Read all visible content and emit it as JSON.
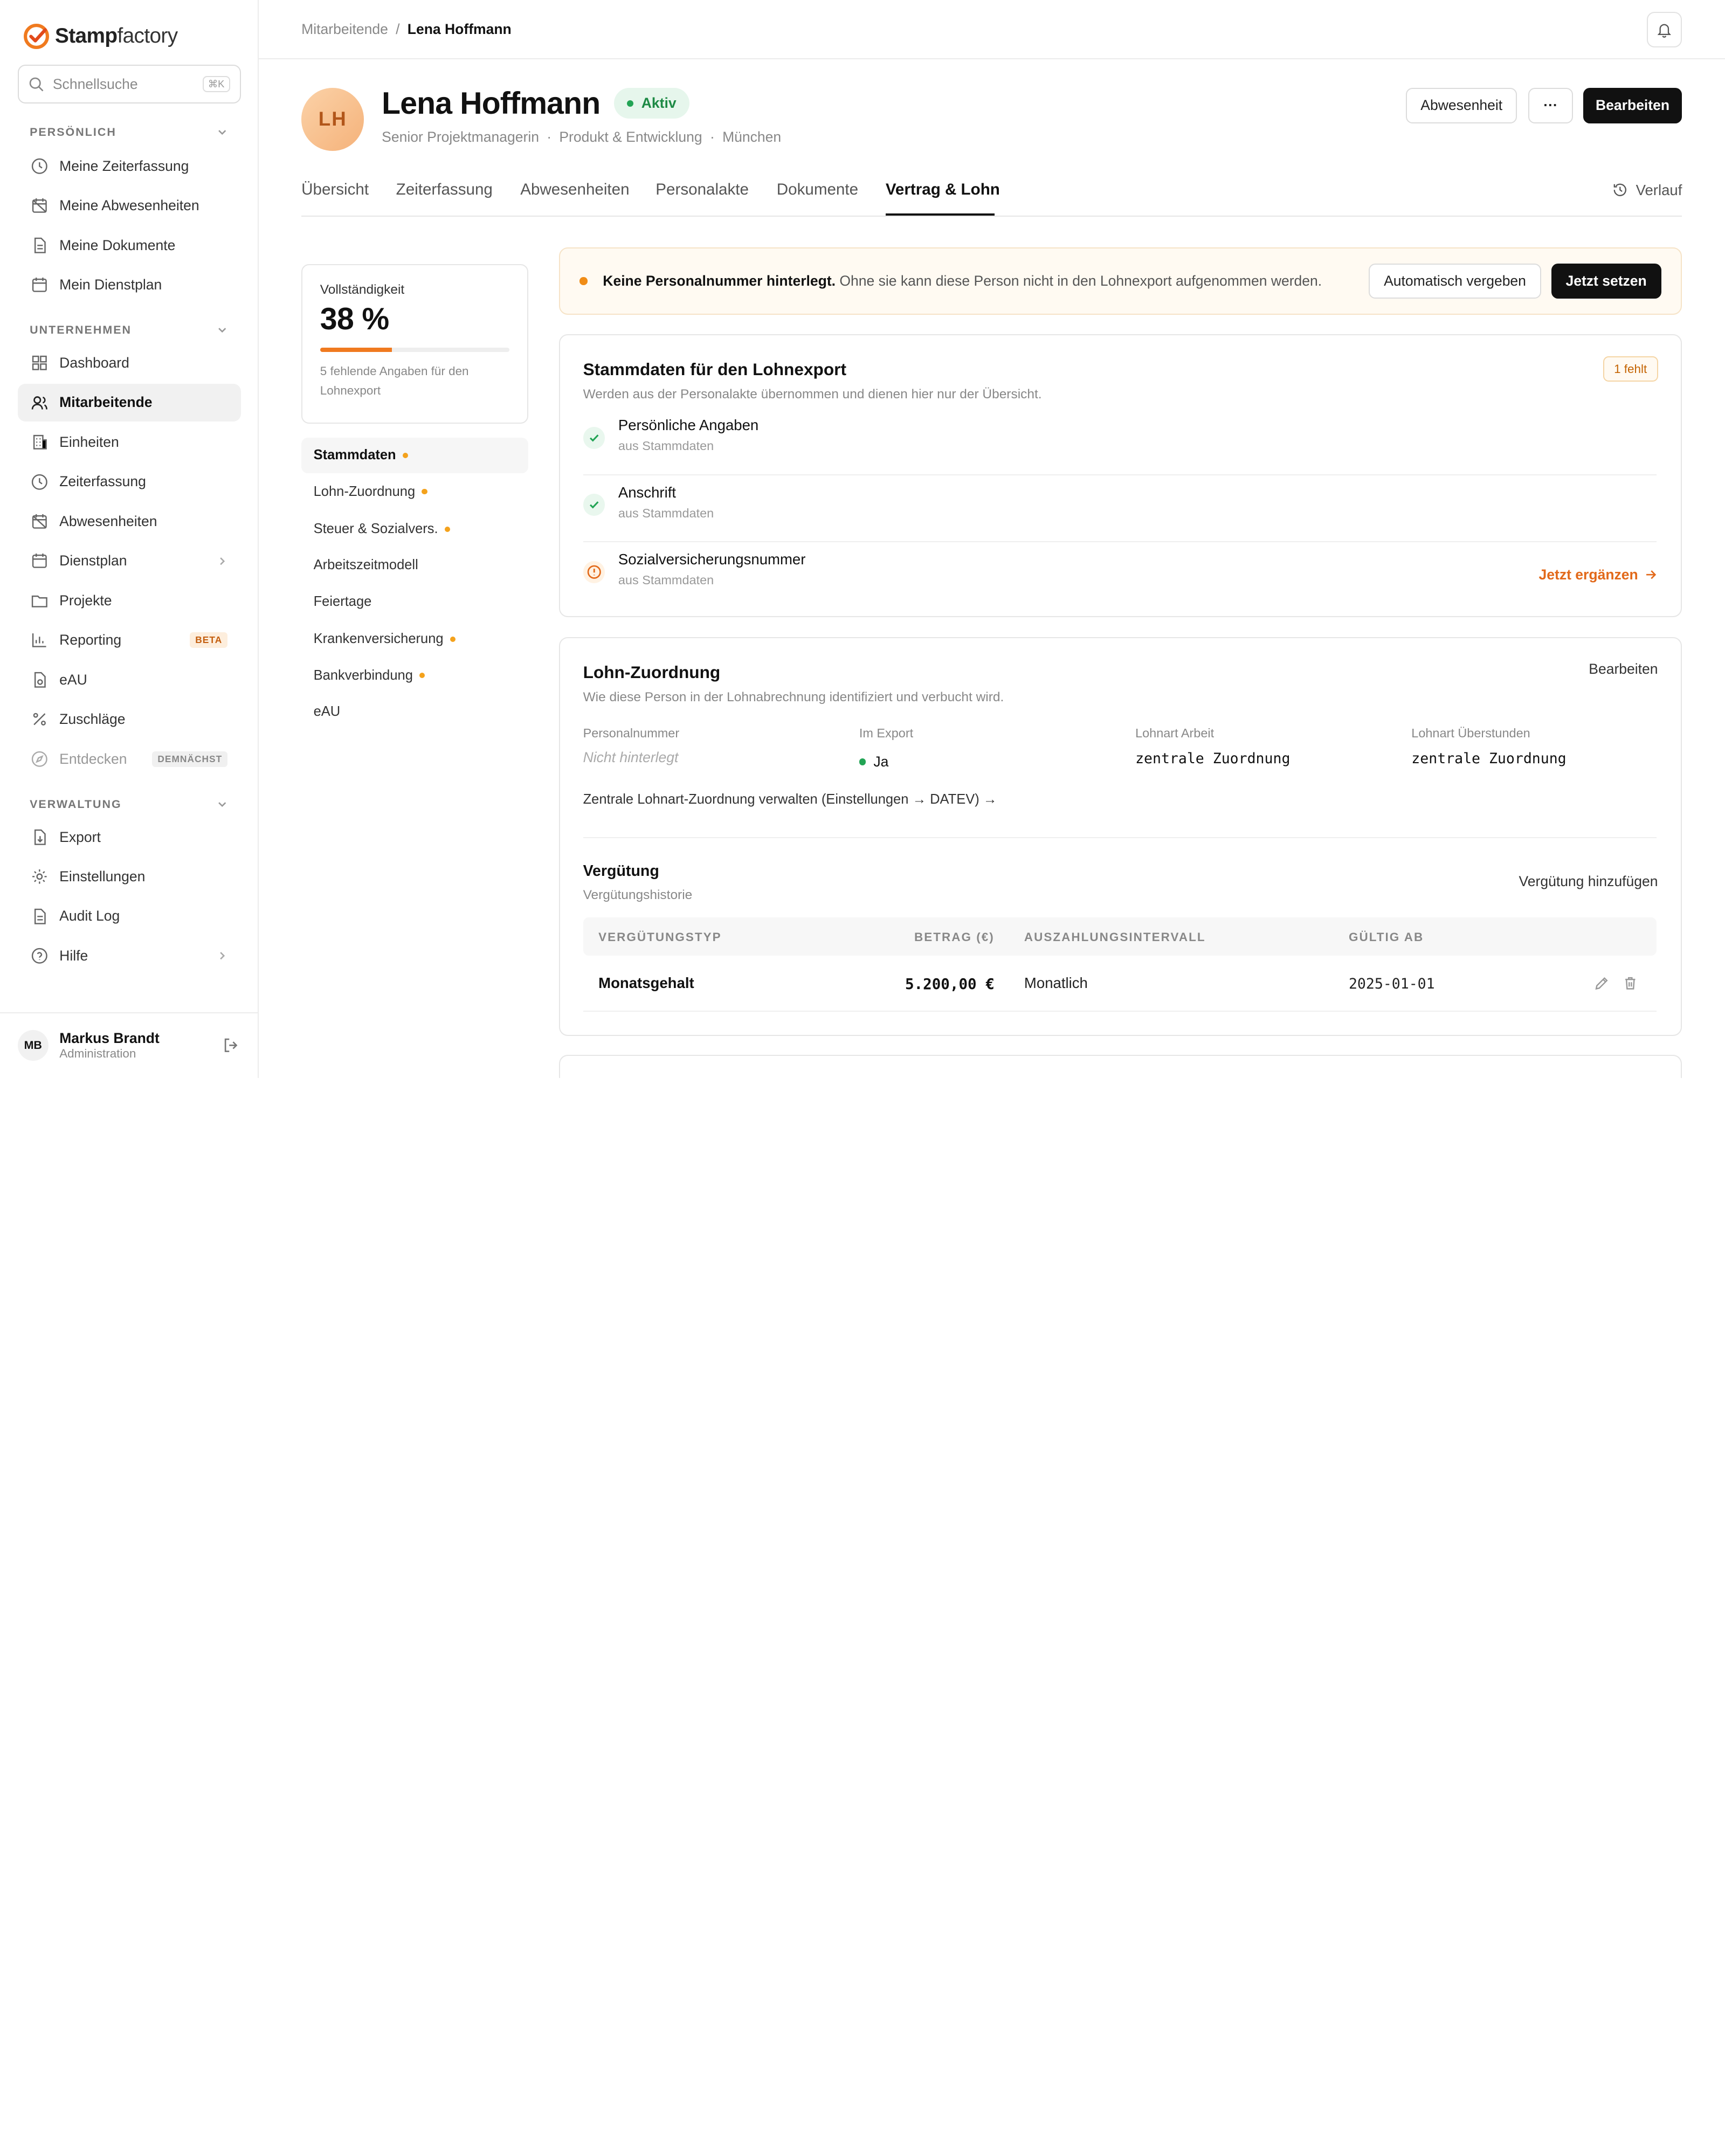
{
  "brand": {
    "part1": "Stamp",
    "part2": "factory"
  },
  "search": {
    "placeholder": "Schnellsuche",
    "shortcut": "⌘K"
  },
  "sidebar": {
    "sections": [
      "PERSÖNLICH",
      "UNTERNEHMEN",
      "VERWALTUNG"
    ],
    "items": [
      {
        "label": "Meine Zeiterfassung",
        "icon": "clock-icon"
      },
      {
        "label": "Meine Abwesenheiten",
        "icon": "calendar-off-icon"
      },
      {
        "label": "Meine Dokumente",
        "icon": "document-icon"
      },
      {
        "label": "Mein Dienstplan",
        "icon": "calendar-icon"
      },
      {
        "label": "Dashboard",
        "icon": "grid-icon"
      },
      {
        "label": "Mitarbeitende",
        "icon": "users-icon"
      },
      {
        "label": "Einheiten",
        "icon": "building-icon"
      },
      {
        "label": "Zeiterfassung",
        "icon": "clock-icon"
      },
      {
        "label": "Abwesenheiten",
        "icon": "calendar-off-icon"
      },
      {
        "label": "Dienstplan",
        "icon": "calendar-icon"
      },
      {
        "label": "Projekte",
        "icon": "folder-icon"
      },
      {
        "label": "Reporting",
        "icon": "chart-icon",
        "badge": "BETA"
      },
      {
        "label": "eAU",
        "icon": "file-icon"
      },
      {
        "label": "Zuschläge",
        "icon": "percent-icon"
      },
      {
        "label": "Entdecken",
        "icon": "compass-icon",
        "badge": "DEMNÄCHST"
      },
      {
        "label": "Export",
        "icon": "export-icon"
      },
      {
        "label": "Einstellungen",
        "icon": "gear-icon"
      },
      {
        "label": "Audit Log",
        "icon": "document-icon"
      },
      {
        "label": "Hilfe",
        "icon": "help-icon"
      }
    ]
  },
  "user": {
    "initials": "MB",
    "name": "Markus Brandt",
    "role": "Administration"
  },
  "breadcrumb": {
    "parent": "Mitarbeitende",
    "sep": "/",
    "current": "Lena Hoffmann"
  },
  "profile": {
    "initials": "LH",
    "name": "Lena Hoffmann",
    "status": "Aktiv",
    "title": "Senior Projektmanagerin",
    "department": "Produkt & Entwicklung",
    "location": "München",
    "dot": "·"
  },
  "actions": {
    "absence": "Abwesenheit",
    "more": "···",
    "edit": "Bearbeiten"
  },
  "tabs": [
    "Übersicht",
    "Zeiterfassung",
    "Abwesenheiten",
    "Personalakte",
    "Dokumente",
    "Vertrag & Lohn"
  ],
  "history": "Verlauf",
  "completeness": {
    "label": "Vollständigkeit",
    "value": "38 %",
    "percent": 0.38,
    "hint": "5 fehlende Angaben für den Lohnexport"
  },
  "subnav": [
    {
      "label": "Stammdaten",
      "missing": true
    },
    {
      "label": "Lohn-Zuordnung",
      "missing": true
    },
    {
      "label": "Steuer & Sozialvers.",
      "missing": true
    },
    {
      "label": "Arbeitszeitmodell",
      "missing": false
    },
    {
      "label": "Feiertage",
      "missing": false
    },
    {
      "label": "Krankenversicherung",
      "missing": true
    },
    {
      "label": "Bankverbindung",
      "missing": true
    },
    {
      "label": "eAU",
      "missing": false
    }
  ],
  "alert": {
    "bold": "Keine Personalnummer hinterlegt.",
    "text": "Ohne sie kann diese Person nicht in den Lohnexport aufgenommen werden.",
    "btn_auto": "Automatisch vergeben",
    "btn_set": "Jetzt setzen"
  },
  "stammdaten": {
    "title": "Stammdaten für den Lohnexport",
    "subtitle": "Werden aus der Personalakte übernommen und dienen hier nur der Übersicht.",
    "badge": "1 fehlt",
    "rows": [
      {
        "title": "Persönliche Angaben",
        "source": "aus Stammdaten",
        "status": "ok"
      },
      {
        "title": "Anschrift",
        "source": "aus Stammdaten",
        "status": "ok"
      },
      {
        "title": "Sozialversicherungsnummer",
        "source": "aus Stammdaten",
        "status": "missing",
        "action": "Jetzt ergänzen"
      }
    ]
  },
  "lohn": {
    "title": "Lohn-Zuordnung",
    "subtitle": "Wie diese Person in der Lohnabrechnung identifiziert und verbucht wird.",
    "edit": "Bearbeiten",
    "fields": [
      {
        "label": "Personalnummer",
        "value": "Nicht hinterlegt"
      },
      {
        "label": "Im Export",
        "value": "Ja"
      },
      {
        "label": "Lohnart Arbeit",
        "value": "zentrale Zuordnung"
      },
      {
        "label": "Lohnart Überstunden",
        "value": "zentrale Zuordnung"
      }
    ],
    "link": "Zentrale Lohnart-Zuordnung verwalten (Einstellungen → DATEV) →"
  },
  "verguetung": {
    "title": "Vergütung",
    "subtitle": "Vergütungshistorie",
    "add": "Vergütung hinzufügen",
    "columns": [
      "VERGÜTUNGSTYP",
      "BETRAG (€)",
      "AUSZAHLUNGSINTERVALL",
      "GÜLTIG AB"
    ],
    "rows": [
      {
        "type": "Monatsgehalt",
        "amount": "5.200,00 €",
        "interval": "Monatlich",
        "valid_from": "2025-01-01"
      }
    ]
  },
  "colors": {
    "accent": "#f07a1f",
    "success": "#22a455",
    "warning": "#f08c16"
  }
}
